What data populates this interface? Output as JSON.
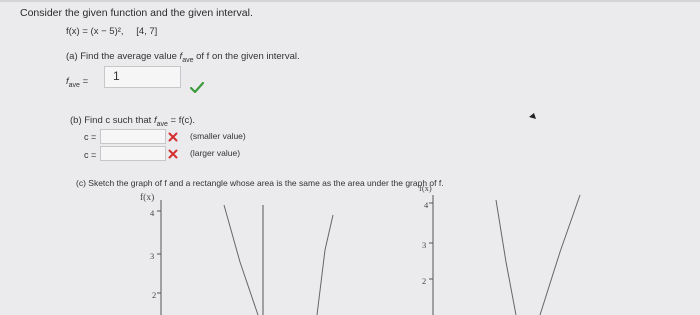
{
  "heading": "Consider the given function and the given interval.",
  "function": {
    "expr": "f(x) = (x − 5)²,",
    "interval": "[4, 7]"
  },
  "part_a": {
    "prompt_pre": "(a) Find the average value ",
    "prompt_fave": "f",
    "prompt_fave_sub": "ave",
    "prompt_post": " of f on the given interval.",
    "lhs": "f",
    "lhs_sub": "ave",
    "equals": " =",
    "answer": "1",
    "status": "correct"
  },
  "part_b": {
    "prompt_pre": "(b) Find c such that ",
    "prompt_f": "f",
    "prompt_sub": "ave",
    "prompt_post": " = f(c).",
    "rows": [
      {
        "label": "c =",
        "value": "",
        "status": "incorrect",
        "hint": "(smaller value)"
      },
      {
        "label": "c =",
        "value": "",
        "status": "incorrect",
        "hint": "(larger value)"
      }
    ]
  },
  "part_c": {
    "prompt": "(c) Sketch the graph of f and a rectangle whose area is the same as the area under the graph of f."
  },
  "graphs": [
    {
      "ylabel": "f(x)",
      "ticks": [
        "4",
        "3",
        "2"
      ]
    },
    {
      "ylabel": "f(x)",
      "ticks": [
        "4",
        "3",
        "2"
      ]
    }
  ],
  "colors": {
    "check": "#3d9b3d",
    "cross": "#d32f2f",
    "page_bg": "#ebebee",
    "input_bg": "#f6f6f7"
  },
  "icons": {
    "correct": "check-icon",
    "incorrect": "x-mark-icon"
  }
}
